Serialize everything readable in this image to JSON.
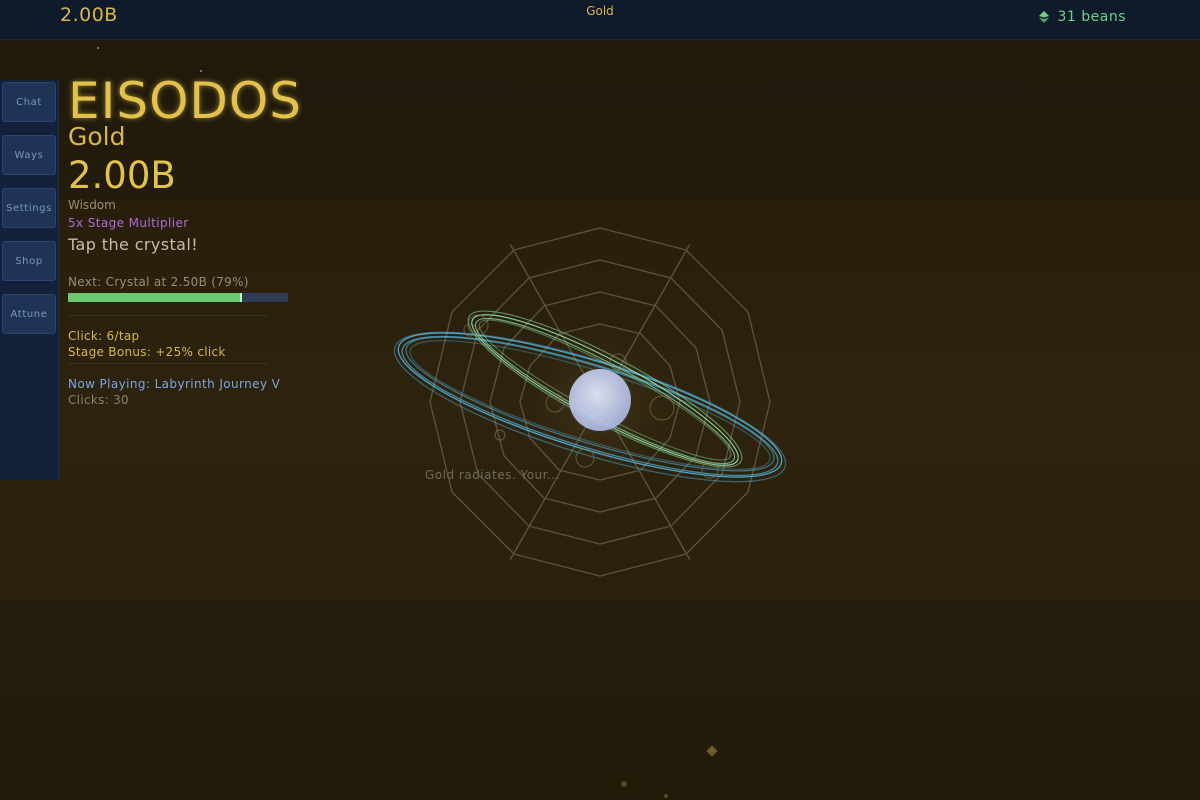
{
  "topbar": {
    "gold_amount": "2.00B",
    "resource_label": "Gold",
    "beans": "31 beans"
  },
  "sidebar": {
    "items": [
      {
        "label": "Chat"
      },
      {
        "label": "Ways"
      },
      {
        "label": "Settings"
      },
      {
        "label": "Shop"
      },
      {
        "label": "Attune"
      }
    ]
  },
  "panel": {
    "title": "EISODOS",
    "resource_name": "Gold",
    "resource_amount": "2.00B",
    "path_name": "Wisdom",
    "multiplier": "5x Stage Multiplier",
    "tap_hint": "Tap the crystal!",
    "next_label": "Next: Crystal at 2.50B (79%)",
    "progress_fraction": 0.79,
    "click_rate": "Click: 6/tap",
    "stage_bonus": "Stage Bonus: +25% click",
    "now_playing": "Now Playing: Labyrinth Journey V",
    "clicks": "Clicks: 30"
  },
  "scene": {
    "flavor_text": "Gold radiates. Your..."
  },
  "colors": {
    "gold": "#d9b54a",
    "beans_green": "#6fd08a",
    "multiplier_purple": "#b06ad6",
    "now_playing_blue": "#7aa6e6",
    "progress_green": "#6cc86f",
    "ring_cyan": "#4fb4e0",
    "ring_green": "#8fe0a8"
  }
}
